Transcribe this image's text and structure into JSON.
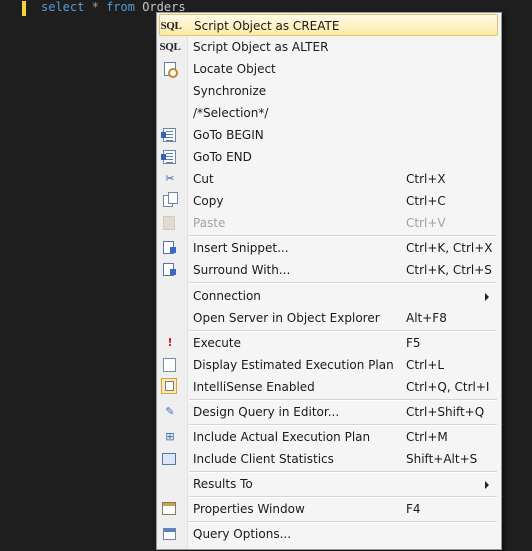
{
  "editor": {
    "code": {
      "kw1": "select",
      "op": "*",
      "kw2": "from",
      "table": "Orders"
    }
  },
  "menu": {
    "items": [
      {
        "label": "Script Object as CREATE",
        "icon": "sql-icon",
        "glyph": "SQL"
      },
      {
        "label": "Script Object as ALTER",
        "icon": "sql-icon",
        "glyph": "SQL"
      },
      {
        "label": "Locate Object",
        "icon": "locate-object-icon"
      },
      {
        "label": "Synchronize"
      },
      {
        "label": "/*Selection*/"
      },
      {
        "label": "GoTo BEGIN",
        "icon": "goto-begin-icon"
      },
      {
        "label": "GoTo END",
        "icon": "goto-end-icon"
      },
      {
        "label": "Cut",
        "shortcut": "Ctrl+X",
        "icon": "cut-icon"
      },
      {
        "label": "Copy",
        "shortcut": "Ctrl+C",
        "icon": "copy-icon"
      },
      {
        "label": "Paste",
        "shortcut": "Ctrl+V",
        "icon": "paste-icon",
        "disabled": true
      },
      {
        "label": "Insert Snippet...",
        "shortcut": "Ctrl+K, Ctrl+X",
        "icon": "insert-snippet-icon"
      },
      {
        "label": "Surround With...",
        "shortcut": "Ctrl+K, Ctrl+S",
        "icon": "surround-with-icon"
      },
      {
        "label": "Connection",
        "submenu": true
      },
      {
        "label": "Open Server in Object Explorer",
        "shortcut": "Alt+F8"
      },
      {
        "label": "Execute",
        "shortcut": "F5",
        "icon": "execute-icon"
      },
      {
        "label": "Display Estimated Execution Plan",
        "shortcut": "Ctrl+L",
        "icon": "execution-plan-icon"
      },
      {
        "label": "IntelliSense Enabled",
        "shortcut": "Ctrl+Q, Ctrl+I",
        "icon": "intellisense-icon",
        "checked": true
      },
      {
        "label": "Design Query in Editor...",
        "shortcut": "Ctrl+Shift+Q",
        "icon": "design-query-icon"
      },
      {
        "label": "Include Actual Execution Plan",
        "shortcut": "Ctrl+M",
        "icon": "actual-plan-icon"
      },
      {
        "label": "Include Client Statistics",
        "shortcut": "Shift+Alt+S",
        "icon": "client-statistics-icon"
      },
      {
        "label": "Results To",
        "submenu": true
      },
      {
        "label": "Properties Window",
        "shortcut": "F4",
        "icon": "properties-icon"
      },
      {
        "label": "Query Options...",
        "icon": "query-options-icon"
      }
    ],
    "highlighted_index": 0
  },
  "colors": {
    "editor_bg": "#1e1e1e",
    "keyword": "#569cd6",
    "highlight_border": "#e6c26b",
    "execute_icon": "#d2211b"
  }
}
